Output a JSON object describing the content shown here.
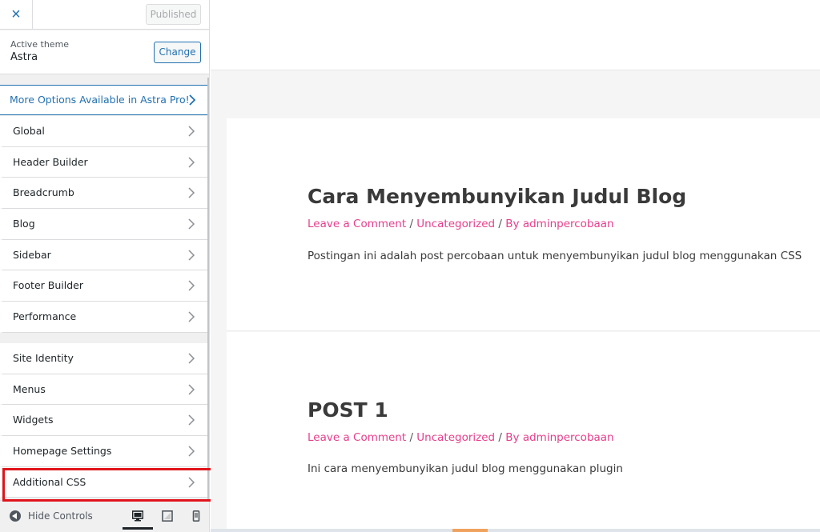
{
  "topbar": {
    "close_icon": "×",
    "publish_label": "Published"
  },
  "theme": {
    "label": "Active theme",
    "name": "Astra",
    "change_label": "Change"
  },
  "pro_banner": {
    "label": "More Options Available in Astra Pro!"
  },
  "astra_sections": [
    {
      "label": "Global"
    },
    {
      "label": "Header Builder"
    },
    {
      "label": "Breadcrumb"
    },
    {
      "label": "Blog"
    },
    {
      "label": "Sidebar"
    },
    {
      "label": "Footer Builder"
    },
    {
      "label": "Performance"
    }
  ],
  "core_sections": [
    {
      "label": "Site Identity"
    },
    {
      "label": "Menus"
    },
    {
      "label": "Widgets"
    },
    {
      "label": "Homepage Settings"
    },
    {
      "label": "Additional CSS"
    }
  ],
  "footer": {
    "hide_controls_label": "Hide Controls",
    "devices": [
      "desktop-icon",
      "tablet-icon",
      "mobile-icon"
    ],
    "active_device": "desktop"
  },
  "posts": [
    {
      "title": "Cara Menyembunyikan Judul Blog",
      "comment_link": "Leave a Comment",
      "category": "Uncategorized",
      "by": "By",
      "author": "adminpercobaan",
      "separator": " / ",
      "excerpt": "Postingan ini adalah post percobaan untuk menyembunyikan judul blog menggunakan CSS"
    },
    {
      "title": "POST 1",
      "comment_link": "Leave a Comment",
      "category": "Uncategorized",
      "by": "By",
      "author": "adminpercobaan",
      "separator": " / ",
      "excerpt": "Ini cara menyembunyikan judul blog menggunakan plugin"
    }
  ],
  "colors": {
    "accent": "#2271b1",
    "link_pink": "#e83e8c",
    "highlight_red": "#e0141b"
  }
}
